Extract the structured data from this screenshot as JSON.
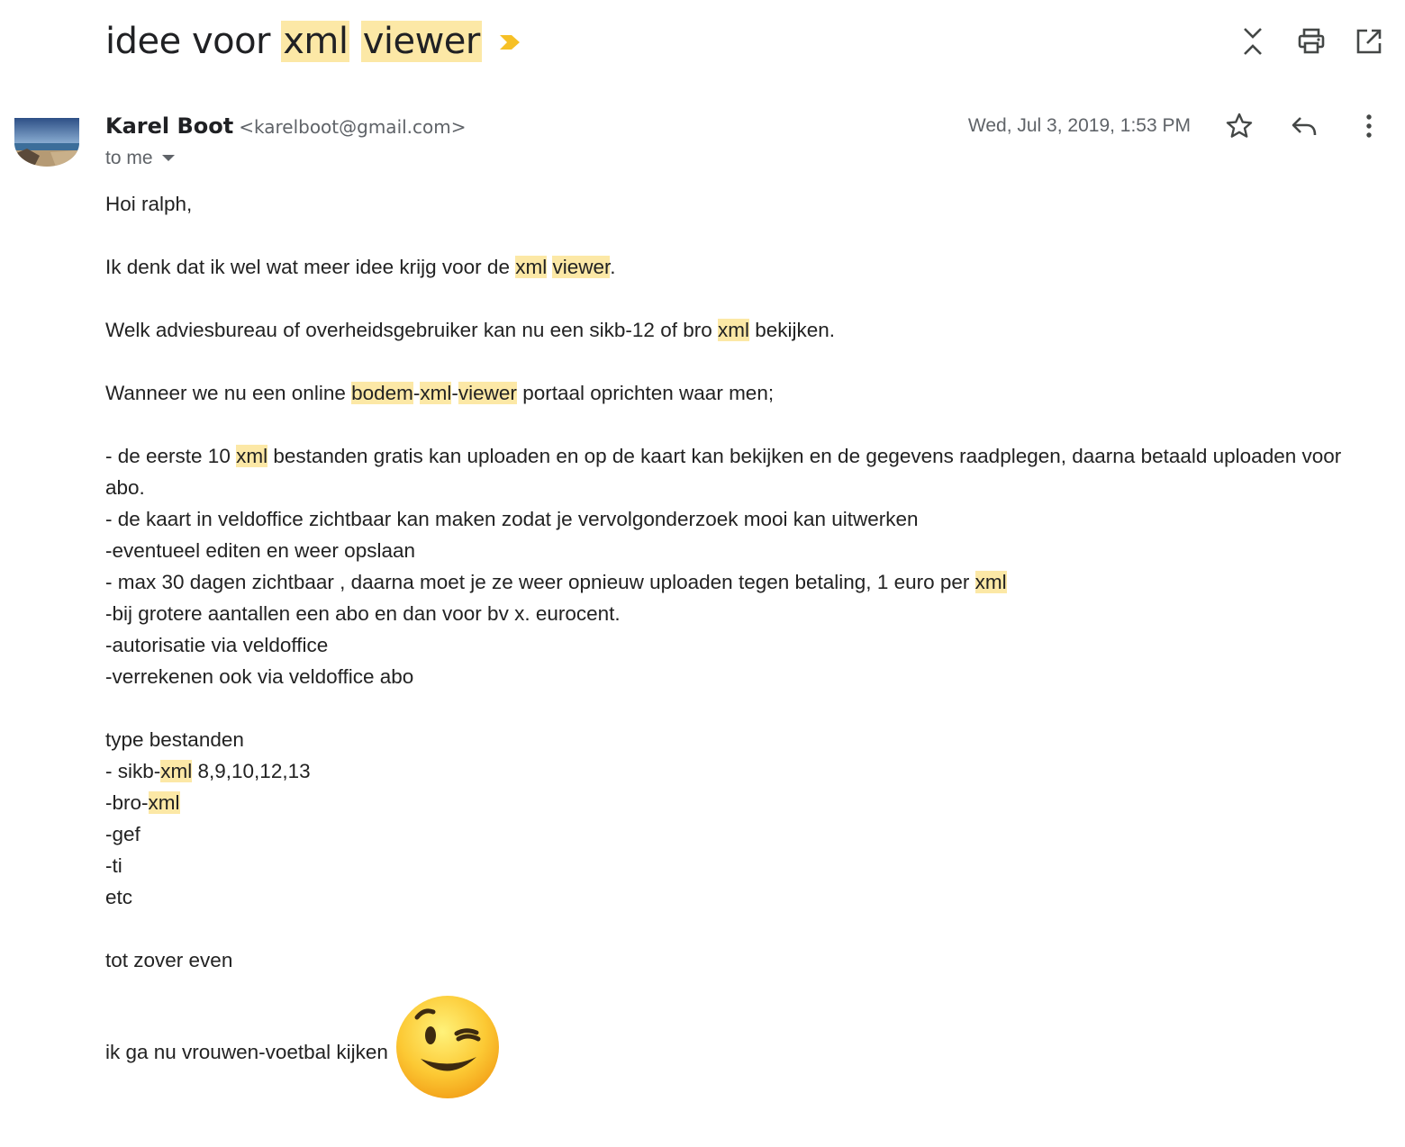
{
  "subject": {
    "prefix": "idee voor ",
    "highlight_1": "xml",
    "space": " ",
    "highlight_2": "viewer"
  },
  "sender": {
    "name": "Karel Boot",
    "email": "<karelboot@gmail.com>"
  },
  "recipients": {
    "label": "to me"
  },
  "date": "Wed, Jul 3, 2019, 1:53 PM",
  "body": {
    "greeting": "Hoi ralph,",
    "p1": {
      "a": "Ik denk dat ik wel wat meer idee krijg voor de ",
      "h1": "xml",
      "sp": " ",
      "h2": "viewer",
      "end": "."
    },
    "p2": {
      "a": "Welk adviesbureau of overheidsgebruiker kan nu een sikb-12 of bro ",
      "h1": "xml",
      "end": " bekijken."
    },
    "p3": {
      "a": "Wanneer we nu een online ",
      "h1": "bodem",
      "d1": "-",
      "h2": "xml",
      "d2": "-",
      "h3": "viewer",
      "end": " portaal oprichten waar men;"
    },
    "list_1": {
      "a": "- de eerste 10 ",
      "h1": "xml",
      "end": " bestanden gratis kan uploaden en op de kaart kan bekijken en de gegevens raadplegen, daarna betaald uploaden voor abo."
    },
    "list_2": "- de kaart in veldoffice zichtbaar kan maken zodat je vervolgonderzoek mooi kan uitwerken",
    "list_3": "-eventueel editen en weer opslaan",
    "list_4": {
      "a": "- max 30 dagen zichtbaar , daarna moet je ze weer opnieuw uploaden tegen betaling, 1 euro per ",
      "h1": "xml"
    },
    "list_5": "-bij grotere aantallen een abo en dan voor bv x. eurocent.",
    "list_6": "-autorisatie via veldoffice",
    "list_7": "-verrekenen ook via veldoffice abo",
    "types_heading": "type bestanden",
    "type_1": {
      "a": "- sikb-",
      "h1": "xml",
      "end": " 8,9,10,12,13"
    },
    "type_2": {
      "a": "-bro-",
      "h1": "xml"
    },
    "type_3": "-gef",
    "type_4": "-ti",
    "type_5": "etc",
    "closing": "tot zover even",
    "sign_off": "ik ga nu vrouwen-voetbal kijken"
  },
  "colors": {
    "highlight": "#fce8a6",
    "important_marker": "#f6c026",
    "icon": "#444746",
    "text": "#222222",
    "muted": "#5f6368"
  },
  "icons": {
    "collapse": "collapse-all-icon",
    "print": "print-icon",
    "open_new_window": "open-in-new-window-icon",
    "star": "star-icon",
    "reply": "reply-icon",
    "more": "more-vertical-icon",
    "dropdown": "caret-down-icon",
    "emoji": "winking-face-emoji"
  }
}
